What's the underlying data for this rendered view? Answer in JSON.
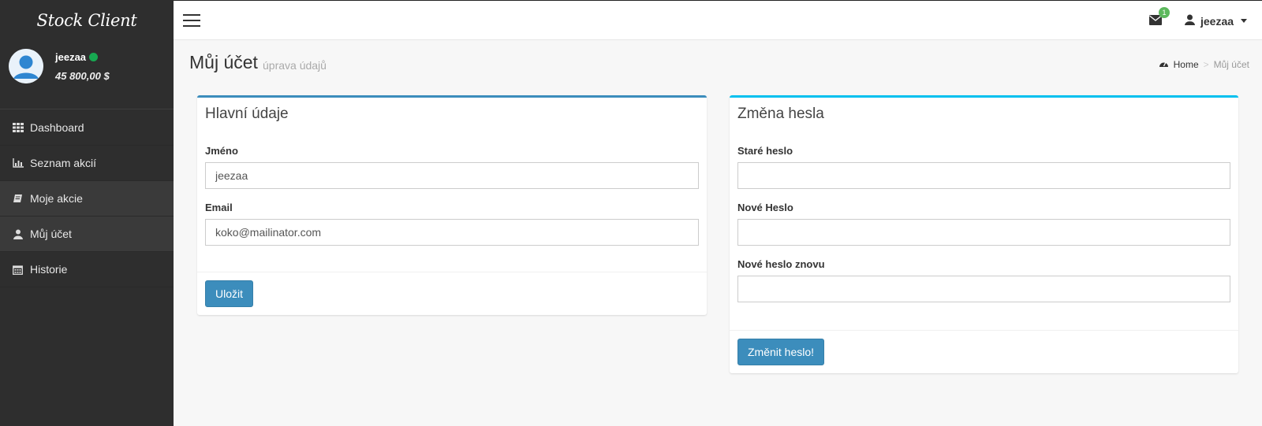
{
  "brand": "Stock Client",
  "user": {
    "name": "jeezaa",
    "balance": "45 800,00 $",
    "status_color": "#17a851"
  },
  "sidebar": {
    "items": [
      {
        "label": "Dashboard",
        "icon": "grid-icon"
      },
      {
        "label": "Seznam akcií",
        "icon": "bar-chart-icon"
      },
      {
        "label": "Moje akcie",
        "icon": "book-icon"
      },
      {
        "label": "Můj účet",
        "icon": "user-icon"
      },
      {
        "label": "Historie",
        "icon": "calendar-icon"
      }
    ],
    "active_index": 3
  },
  "header": {
    "mail_count": "1",
    "user_label": "jeezaa"
  },
  "page": {
    "title": "Můj účet",
    "subtitle": "úprava údajů",
    "breadcrumb": {
      "home": "Home",
      "current": "Můj účet"
    }
  },
  "main_box": {
    "title": "Hlavní údaje",
    "name_label": "Jméno",
    "name_value": "jeezaa",
    "email_label": "Email",
    "email_value": "koko@mailinator.com",
    "save_label": "Uložit"
  },
  "password_box": {
    "title": "Změna hesla",
    "old_label": "Staré heslo",
    "new_label": "Nové Heslo",
    "repeat_label": "Nové heslo znovu",
    "submit_label": "Změnit heslo!"
  },
  "colors": {
    "sidebar_bg": "#2e2e2e",
    "accent_blue": "#3c8dbc",
    "box_border_left": "#3c8dbc",
    "box_border_right": "#00c0ef",
    "badge_green": "#5cb85c"
  }
}
